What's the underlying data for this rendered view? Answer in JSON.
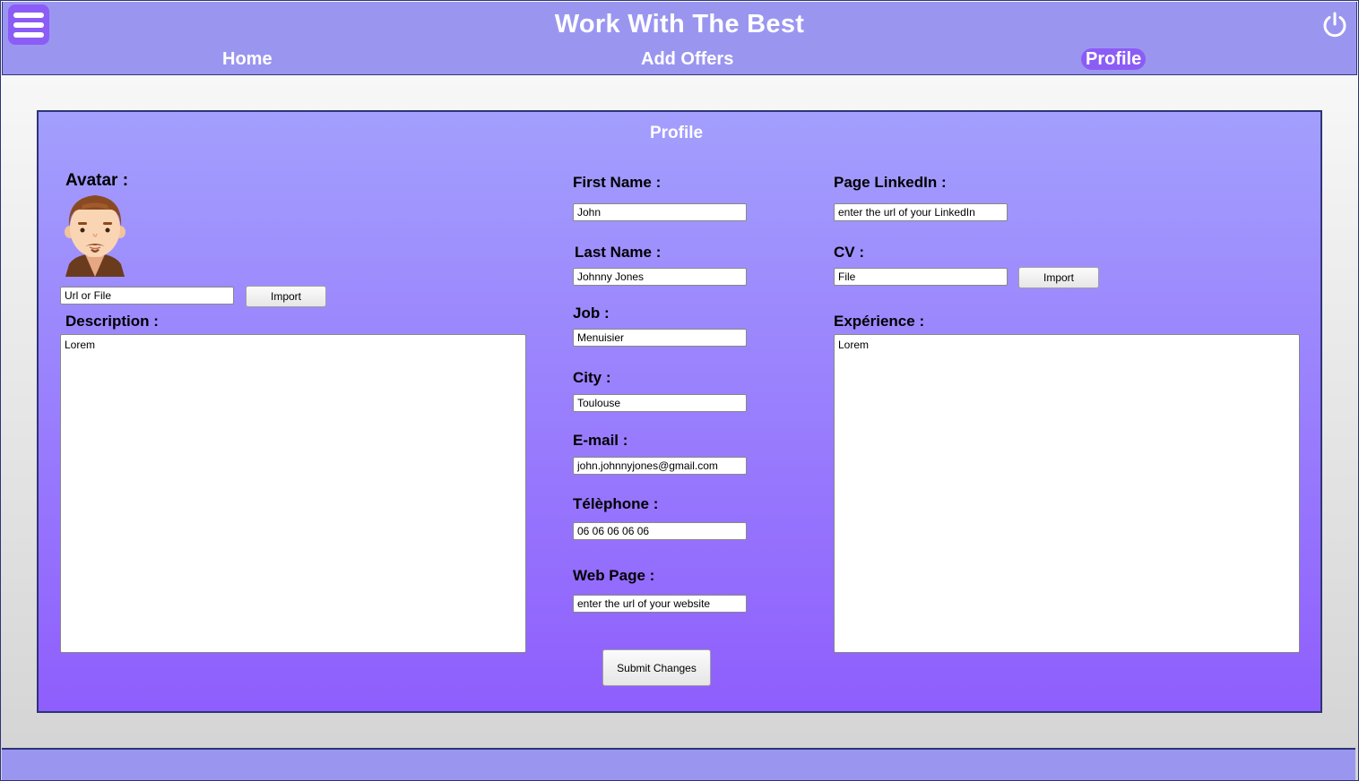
{
  "header": {
    "title": "Work With The Best",
    "nav": {
      "home": "Home",
      "add_offers": "Add Offers",
      "profile": "Profile"
    },
    "active_nav": "Profile",
    "menu_icon": "hamburger-menu-icon",
    "power_icon": "power-icon"
  },
  "panel": {
    "title": "Profile",
    "avatar": {
      "label": "Avatar :",
      "icon": "user-avatar-icon",
      "input_value": "Url or File",
      "import_label": "Import"
    },
    "description": {
      "label": "Description :",
      "value": "Lorem"
    },
    "fields": {
      "first_name": {
        "label": "First Name :",
        "value": "John"
      },
      "last_name": {
        "label": "Last Name :",
        "value": "Johnny Jones"
      },
      "job": {
        "label": "Job :",
        "value": "Menuisier"
      },
      "city": {
        "label": "City :",
        "value": "Toulouse"
      },
      "email": {
        "label": "E-mail :",
        "value": "john.johnnyjones@gmail.com"
      },
      "telephone": {
        "label": "Télèphone :",
        "value": "06 06 06 06 06"
      },
      "web_page": {
        "label": "Web Page :",
        "value": "enter the url of your website"
      }
    },
    "linkedin": {
      "label": "Page LinkedIn :",
      "value": "enter the url of your LinkedIn"
    },
    "cv": {
      "label": "CV :",
      "value": "File",
      "import_label": "Import"
    },
    "experience": {
      "label": "Expérience :",
      "value": "Lorem"
    },
    "submit_label": "Submit Changes"
  },
  "colors": {
    "header_bg": "#9a96f0",
    "accent": "#8b5cf6",
    "border": "#2d3478",
    "panel_top": "#a39ffd",
    "panel_bottom": "#8f5efd"
  }
}
